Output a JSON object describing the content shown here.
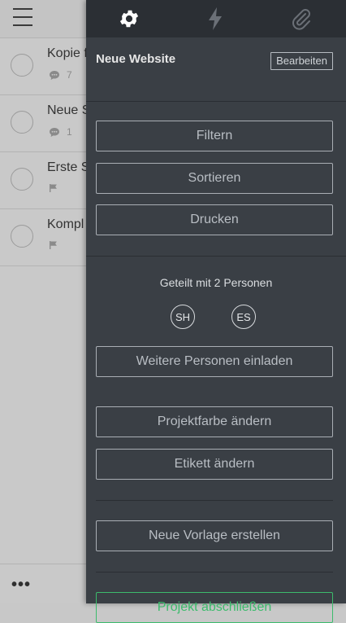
{
  "tasks": [
    {
      "title": "Kopie f",
      "comments": "7",
      "has_flag": false
    },
    {
      "title": "Neue S",
      "comments": "1",
      "has_flag": false
    },
    {
      "title": "Erste S",
      "comments": "",
      "has_flag": true
    },
    {
      "title": "Kompl",
      "comments": "",
      "has_flag": true
    }
  ],
  "bottom": {
    "more_label": "•••"
  },
  "panel": {
    "project_title": "Neue Website",
    "edit_label": "Bearbeiten",
    "filter_label": "Filtern",
    "sort_label": "Sortieren",
    "print_label": "Drucken",
    "shared_text": "Geteilt mit 2 Personen",
    "avatars": [
      "SH",
      "ES"
    ],
    "invite_label": "Weitere Personen einladen",
    "project_color_label": "Projektfarbe ändern",
    "tag_label": "Etikett ändern",
    "template_label": "Neue Vorlage erstellen",
    "complete_label": "Projekt abschließen"
  },
  "colors": {
    "panel_bg": "#3a3f45",
    "tab_bar": "#2b2f34",
    "accent_green": "#3cbb6c"
  }
}
